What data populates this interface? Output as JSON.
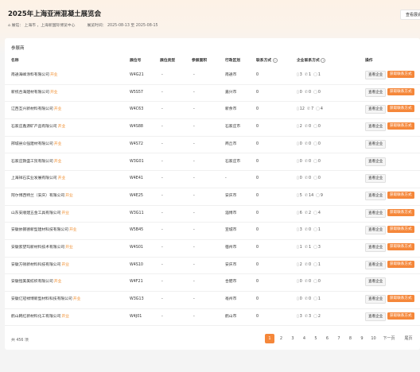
{
  "header": {
    "title": "2025年上海亚洲混凝土展览会",
    "top_button": "查看展会",
    "location_label": "展馆：",
    "location": "上海市 ，上海新国际博览中心",
    "time_label": "展览时间：",
    "time": "2025-08-13 至 2025-08-15"
  },
  "card": {
    "title": "参展商"
  },
  "columns": {
    "name": "名称",
    "booth": "展位号",
    "booth_type": "展位类型",
    "booth_area": "参展面积",
    "region": "行政区划",
    "contact": "联系方式",
    "company_contact": "企业联系方式",
    "ops": "操作"
  },
  "open_tag": "开业",
  "view_label": "查看企业",
  "contact_label": "获取联系方式",
  "rows": [
    {
      "name": "南通海峰涂料有限公司",
      "booth": "W4G21",
      "type": "-",
      "area": "-",
      "region": "南通市",
      "contact": "0",
      "p": "3",
      "e": "1",
      "m": "1",
      "btn": true
    },
    {
      "name": "新统合海建材有限公司",
      "booth": "W5S57",
      "type": "-",
      "area": "-",
      "region": "嘉兴市",
      "contact": "0",
      "p": "0",
      "e": "0",
      "m": "0",
      "btn": true
    },
    {
      "name": "辽西互兴新材料有限公司",
      "booth": "W4C63",
      "type": "-",
      "area": "-",
      "region": "新余市",
      "contact": "0",
      "p": "12",
      "e": "7",
      "m": "4",
      "btn": true
    },
    {
      "name": "石家庄鑫源矿产品有限公司",
      "booth": "W4S88",
      "type": "-",
      "area": "-",
      "region": "石家庄市",
      "contact": "0",
      "p": "2",
      "e": "0",
      "m": "0",
      "btn": true
    },
    {
      "name": "邢城县众强建材有限公司",
      "booth": "W4S72",
      "type": "-",
      "area": "-",
      "region": "商丘市",
      "contact": "0",
      "p": "0",
      "e": "0",
      "m": "0",
      "btn": false
    },
    {
      "name": "石家庄颢盛工贸有限公司",
      "booth": "W3G01",
      "type": "-",
      "area": "-",
      "region": "石家庄市",
      "contact": "0",
      "p": "0",
      "e": "0",
      "m": "0",
      "btn": false
    },
    {
      "name": "上海祥石实业发展有限公司",
      "booth": "W4E41",
      "type": "-",
      "area": "-",
      "region": "-",
      "contact": "0",
      "p": "0",
      "e": "0",
      "m": "0",
      "btn": false
    },
    {
      "name": "阿尔博西特兰（安庆）有限公司",
      "booth": "W4E25",
      "type": "-",
      "area": "-",
      "region": "安庆市",
      "contact": "0",
      "p": "5",
      "e": "14",
      "m": "9",
      "btn": true
    },
    {
      "name": "山东安顺建五金工具有限公司",
      "booth": "W3G11",
      "type": "-",
      "area": "-",
      "region": "淄博市",
      "contact": "0",
      "p": "6",
      "e": "2",
      "m": "4",
      "btn": true
    },
    {
      "name": "安徽依钢德新型建材科技有限公司",
      "booth": "W5B45",
      "type": "-",
      "area": "-",
      "region": "宣城市",
      "contact": "0",
      "p": "3",
      "e": "0",
      "m": "1",
      "btn": true
    },
    {
      "name": "安徽索望玛新材料技术有限公司",
      "booth": "W4S01",
      "type": "-",
      "area": "-",
      "region": "宿州市",
      "contact": "0",
      "p": "1",
      "e": "1",
      "m": "3",
      "btn": true
    },
    {
      "name": "安徽方顿新材料科技有限公司",
      "booth": "W4S10",
      "type": "-",
      "area": "-",
      "region": "安庆市",
      "contact": "0",
      "p": "2",
      "e": "0",
      "m": "1",
      "btn": true
    },
    {
      "name": "安徽恒美美纺织有限公司",
      "booth": "W4F21",
      "type": "-",
      "area": "-",
      "region": "合肥市",
      "contact": "0",
      "p": "0",
      "e": "0",
      "m": "0",
      "btn": false
    },
    {
      "name": "安徽亿冠禄博新型材料科技有限公司",
      "booth": "W3G13",
      "type": "-",
      "area": "-",
      "region": "亳州市",
      "contact": "0",
      "p": "0",
      "e": "0",
      "m": "1",
      "btn": true
    },
    {
      "name": "鹤山韩红新材料化工有限公司",
      "booth": "W4J01",
      "type": "-",
      "area": "-",
      "region": "鹤山市",
      "contact": "0",
      "p": "3",
      "e": "3",
      "m": "2",
      "btn": true
    }
  ],
  "footer": {
    "total": "共 456 项",
    "pages": [
      "1",
      "2",
      "3",
      "4",
      "5",
      "6",
      "7",
      "8",
      "9",
      "10"
    ],
    "next": "下一页",
    "last": "尾页"
  }
}
